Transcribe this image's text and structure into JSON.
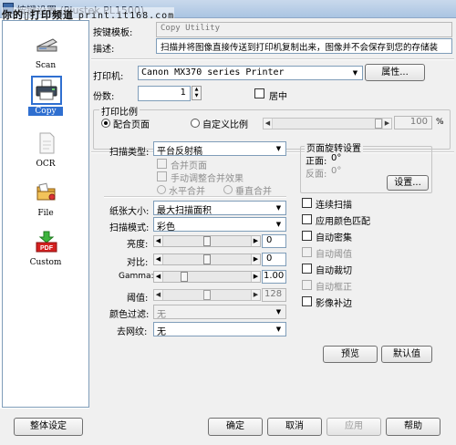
{
  "window": {
    "title": "按键设置 (Plustek PL1500)",
    "watermark_text": "你的",
    "watermark_brand": "打印频道",
    "watermark_url": "print.it168.com"
  },
  "sidebar": {
    "items": [
      {
        "label": "Scan",
        "icon": "scanner-icon",
        "selected": false
      },
      {
        "label": "Copy",
        "icon": "printer-icon",
        "selected": true
      },
      {
        "label": "OCR",
        "icon": "ocr-document-icon",
        "selected": false
      },
      {
        "label": "File",
        "icon": "file-folder-icon",
        "selected": false
      },
      {
        "label": "Custom",
        "icon": "pdf-icon",
        "selected": false
      }
    ]
  },
  "header": {
    "template_label": "按键模板:",
    "template_value": "Copy Utility",
    "desc_label": "描述:",
    "desc_value": "扫描并将图像直接传送到打印机复制出来，图像并不会保存到您的存储装"
  },
  "printer": {
    "printer_label": "打印机:",
    "printer_value": "Canon MX370 series Printer",
    "properties_button": "属性...",
    "copies_label": "份数:",
    "copies_value": "1",
    "center_label": "居中",
    "ratio_title": "打印比例",
    "fit_page_label": "配合页面",
    "custom_ratio_label": "自定义比例",
    "ratio_value": "100",
    "ratio_unit": "%"
  },
  "scan": {
    "scan_type_label": "扫描类型:",
    "scan_type_value": "平台反射稿",
    "merge_page_label": "合并页面",
    "manual_merge_label": "手动调整合并效果",
    "horizontal_merge_label": "水平合并",
    "vertical_merge_label": "垂直合并",
    "paper_size_label": "纸张大小:",
    "paper_size_value": "最大扫描面积",
    "scan_mode_label": "扫描模式:",
    "scan_mode_value": "彩色",
    "brightness_label": "亮度:",
    "brightness_value": "0",
    "brightness_level": 0.5,
    "contrast_label": "对比:",
    "contrast_value": "0",
    "contrast_level": 0.5,
    "gamma_label": "Gamma:",
    "gamma_value": "1.00",
    "gamma_level": 0.22,
    "threshold_label": "阈值:",
    "threshold_value": "128",
    "threshold_level": 0.5,
    "color_filter_label": "颜色过滤:",
    "color_filter_value": "无",
    "descreen_label": "去网纹:",
    "descreen_value": "无"
  },
  "rotation": {
    "title": "页面旋转设置",
    "front_label": "正面:",
    "front_value": "0°",
    "back_label": "反面:",
    "back_value": "0°",
    "settings_button": "设置..."
  },
  "options": [
    {
      "label": "连续扫描",
      "enabled": true
    },
    {
      "label": "应用颜色匹配",
      "enabled": true
    },
    {
      "label": "自动密集",
      "enabled": true
    },
    {
      "label": "自动阈值",
      "enabled": false
    },
    {
      "label": "自动裁切",
      "enabled": true
    },
    {
      "label": "自动框正",
      "enabled": false
    },
    {
      "label": "影像补边",
      "enabled": true
    }
  ],
  "actions": {
    "preview": "预览",
    "defaults": "默认值"
  },
  "footer": {
    "global_settings": "整体设定",
    "ok": "确定",
    "cancel": "取消",
    "apply": "应用",
    "help": "帮助"
  }
}
